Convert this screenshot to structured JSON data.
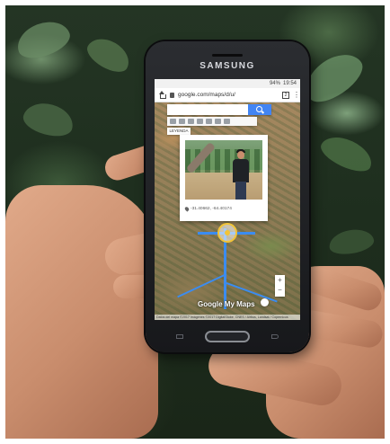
{
  "phone": {
    "brand": "SAMSUNG"
  },
  "status_bar": {
    "battery_percent": "94%",
    "time": "19:54"
  },
  "browser": {
    "url": "google.com/maps/d/u/",
    "tab_count": "2"
  },
  "map": {
    "layer_label": "LEYENDA",
    "coordinates": "-31.40662, -64.40174",
    "logo": "Google My Maps",
    "attribution": "Datos del mapa ©2017 Imágenes ©2017 DigitalGlobe, CNES / Airbus, Landsat / Copernicus"
  },
  "colors": {
    "search_button": "#4285f4",
    "route": "#3b8cf0",
    "pegman": "#f2c438"
  }
}
